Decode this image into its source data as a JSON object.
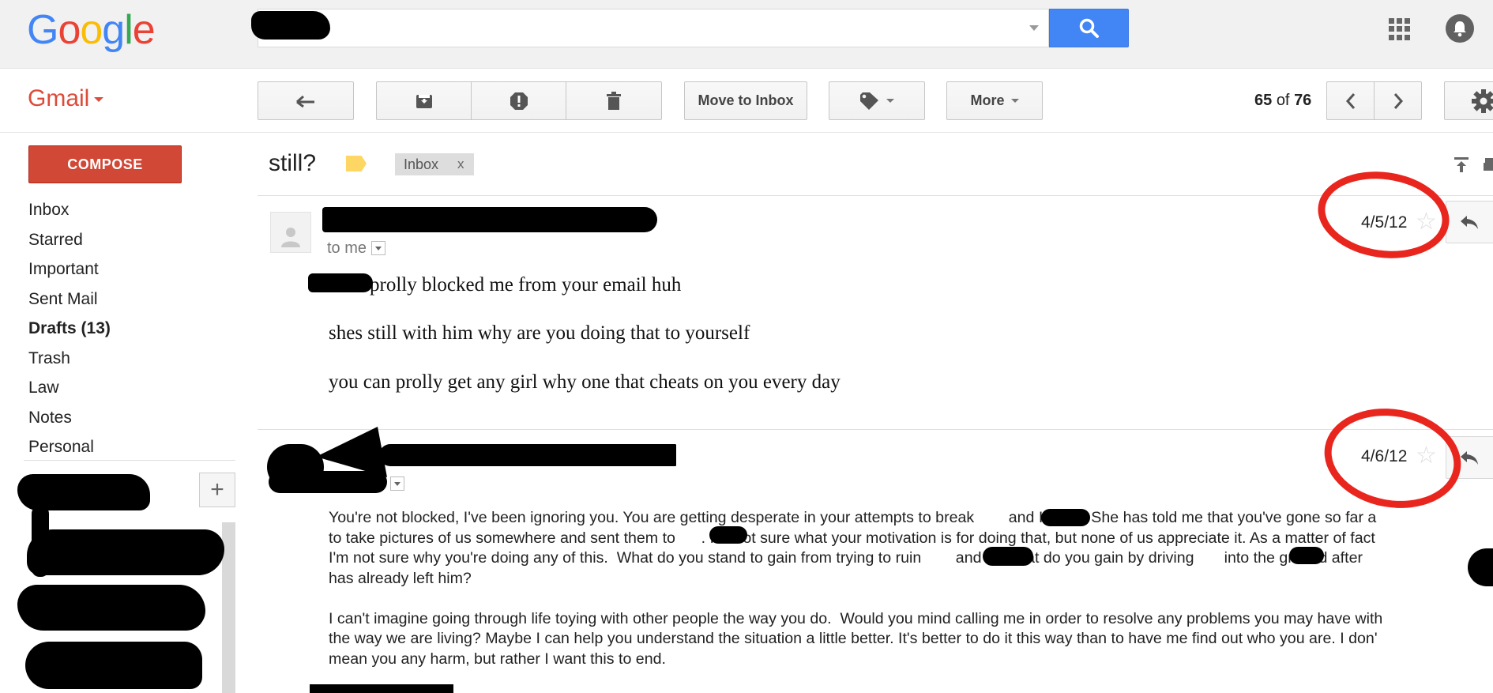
{
  "brand": {
    "logo_letters": [
      "G",
      "o",
      "o",
      "g",
      "l",
      "e"
    ],
    "logo_colors": [
      "#4285f4",
      "#ea4335",
      "#fbbc05",
      "#4285f4",
      "#34a853",
      "#ea4335"
    ],
    "product": "Gmail"
  },
  "toolbar": {
    "move_to_inbox": "Move to Inbox",
    "more": "More",
    "pager_current": "65",
    "pager_of": "of",
    "pager_total": "76"
  },
  "sidebar": {
    "compose": "COMPOSE",
    "items": [
      {
        "label": "Inbox",
        "bold": false
      },
      {
        "label": "Starred",
        "bold": false
      },
      {
        "label": "Important",
        "bold": false
      },
      {
        "label": "Sent Mail",
        "bold": false
      },
      {
        "label": "Drafts (13)",
        "bold": true
      },
      {
        "label": "Trash",
        "bold": false
      },
      {
        "label": "Law",
        "bold": false
      },
      {
        "label": "Notes",
        "bold": false
      },
      {
        "label": "Personal",
        "bold": false
      }
    ],
    "add_label": "+"
  },
  "thread": {
    "subject": "still?",
    "chip_label": "Inbox",
    "chip_close": "x",
    "messages": [
      {
        "recipient": "to me",
        "date": "4/5/12",
        "lines": [
          "prolly blocked me from your email huh",
          "shes still with him  why are you doing that to yourself",
          "you can prolly get any girl why one that cheats on you every day"
        ]
      },
      {
        "date": "4/6/12",
        "body": "You're not blocked, I've been ignoring you. You are getting desperate in your attempts to break        and I apart. She has told me that you've gone so far a\nto take pictures of us somewhere and sent them to      . I'm not sure what your motivation is for doing that, but none of us appreciate it. As a matter of fact\nI'm not sure why you're doing any of this.  What do you stand to gain from trying to ruin        and I? What do you gain by driving       into the ground after\nhas already left him?\n\nI can't imagine going through life toying with other people the way you do.  Would you mind calling me in order to resolve any problems you may have with\nthe way we are living? Maybe I can help you understand the situation a little better. It's better to do it this way than to have me find out who you are. I don'\nmean you any harm, but rather I want this to end."
      }
    ]
  },
  "colors": {
    "search_button": "#4285f4",
    "compose_button": "#d14836",
    "gmail_red": "#dd4b39",
    "annotation_red": "#e8261e"
  },
  "icons": [
    "search-icon",
    "apps-grid-icon",
    "notifications-icon",
    "back-arrow-icon",
    "archive-icon",
    "report-spam-icon",
    "delete-icon",
    "label-icon",
    "chevron-left-icon",
    "chevron-right-icon",
    "settings-gear-icon",
    "print-icon",
    "reply-icon",
    "star-icon",
    "person-icon"
  ]
}
